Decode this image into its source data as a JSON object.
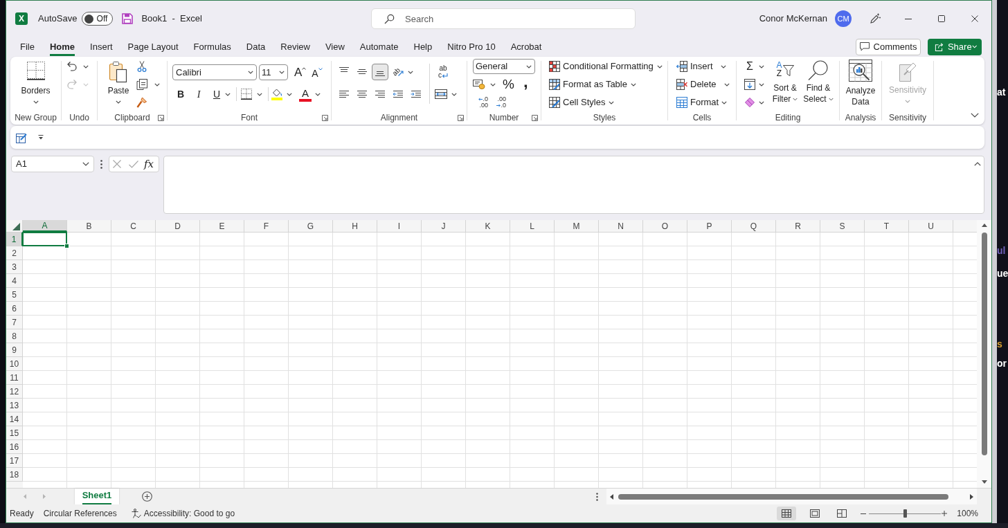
{
  "title_bar": {
    "app_icon_letter": "X",
    "autosave": {
      "label": "AutoSave",
      "on": false,
      "state_label": "Off"
    },
    "document_title": "Book1  -  Excel",
    "search": {
      "placeholder": "Search"
    },
    "account": {
      "name": "Conor McKernan",
      "initials": "CM"
    }
  },
  "ribbon_tabs": [
    {
      "label": "File",
      "selected": false
    },
    {
      "label": "Home",
      "selected": true
    },
    {
      "label": "Insert",
      "selected": false
    },
    {
      "label": "Page Layout",
      "selected": false
    },
    {
      "label": "Formulas",
      "selected": false
    },
    {
      "label": "Data",
      "selected": false
    },
    {
      "label": "Review",
      "selected": false
    },
    {
      "label": "View",
      "selected": false
    },
    {
      "label": "Automate",
      "selected": false
    },
    {
      "label": "Help",
      "selected": false
    },
    {
      "label": "Nitro Pro 10",
      "selected": false
    },
    {
      "label": "Acrobat",
      "selected": false
    }
  ],
  "comments_button": {
    "label": "Comments"
  },
  "share_button": {
    "label": "Share"
  },
  "ribbon": {
    "new_group": {
      "label": "New Group",
      "borders_button": "Borders"
    },
    "undo": {
      "label": "Undo",
      "undo_disabled": false,
      "redo_disabled": true
    },
    "clipboard": {
      "label": "Clipboard",
      "paste_button": "Paste"
    },
    "font": {
      "label": "Font",
      "font_name": "Calibri",
      "font_size": "11",
      "grow_glyph": "A",
      "shrink_glyph": "A",
      "bold_glyph": "B",
      "italic_glyph": "I",
      "underline_glyph": "U",
      "font_color_glyph": "A"
    },
    "alignment": {
      "label": "Alignment",
      "orientation_glyph": "ab",
      "wrap_glyph": [
        "ab",
        "c"
      ],
      "vertical_align": [
        {
          "selected": false
        },
        {
          "selected": false
        },
        {
          "selected": true
        }
      ]
    },
    "number": {
      "label": "Number",
      "format": "General",
      "percent_glyph": "%",
      "comma_glyph": ",",
      "increase_decimal": [
        ".0",
        ".00"
      ],
      "decrease_decimal": [
        ".00",
        ".0"
      ]
    },
    "styles": {
      "label": "Styles",
      "buttons": [
        "Conditional Formatting",
        "Format as Table",
        "Cell Styles"
      ]
    },
    "cells": {
      "label": "Cells",
      "buttons": [
        {
          "label": "Insert",
          "kind": "split"
        },
        {
          "label": "Delete",
          "kind": "split"
        },
        {
          "label": "Format",
          "kind": "menu"
        }
      ]
    },
    "editing": {
      "label": "Editing",
      "sum_glyph": "Σ",
      "sort_glyph": [
        "A",
        "Z"
      ],
      "sort_filter": [
        "Sort &",
        "Filter"
      ],
      "find_select": [
        "Find &",
        "Select"
      ]
    },
    "analysis": {
      "label": "Analysis",
      "analyze_data": [
        "Analyze",
        "Data"
      ]
    },
    "sensitivity": {
      "label": "Sensitivity",
      "button": {
        "label": "Sensitivity",
        "disabled": true
      }
    }
  },
  "formula_bar": {
    "name_box": "A1",
    "function_glyph": "fx",
    "expanded": true
  },
  "sheet": {
    "columns": [
      {
        "label": "A",
        "selected": true
      },
      {
        "label": "B",
        "selected": false
      },
      {
        "label": "C",
        "selected": false
      },
      {
        "label": "D",
        "selected": false
      },
      {
        "label": "E",
        "selected": false
      },
      {
        "label": "F",
        "selected": false
      },
      {
        "label": "G",
        "selected": false
      },
      {
        "label": "H",
        "selected": false
      },
      {
        "label": "I",
        "selected": false
      },
      {
        "label": "J",
        "selected": false
      },
      {
        "label": "K",
        "selected": false
      },
      {
        "label": "L",
        "selected": false
      },
      {
        "label": "M",
        "selected": false
      },
      {
        "label": "N",
        "selected": false
      },
      {
        "label": "O",
        "selected": false
      },
      {
        "label": "P",
        "selected": false
      },
      {
        "label": "Q",
        "selected": false
      },
      {
        "label": "R",
        "selected": false
      },
      {
        "label": "S",
        "selected": false
      },
      {
        "label": "T",
        "selected": false
      },
      {
        "label": "U",
        "selected": false
      }
    ],
    "rows": [
      {
        "label": "1",
        "selected": true
      },
      {
        "label": "2",
        "selected": false
      },
      {
        "label": "3",
        "selected": false
      },
      {
        "label": "4",
        "selected": false
      },
      {
        "label": "5",
        "selected": false
      },
      {
        "label": "6",
        "selected": false
      },
      {
        "label": "7",
        "selected": false
      },
      {
        "label": "8",
        "selected": false
      },
      {
        "label": "9",
        "selected": false
      },
      {
        "label": "10",
        "selected": false
      },
      {
        "label": "11",
        "selected": false
      },
      {
        "label": "12",
        "selected": false
      },
      {
        "label": "13",
        "selected": false
      },
      {
        "label": "14",
        "selected": false
      },
      {
        "label": "15",
        "selected": false
      },
      {
        "label": "16",
        "selected": false
      },
      {
        "label": "17",
        "selected": false
      },
      {
        "label": "18",
        "selected": false
      }
    ]
  },
  "sheet_tabs": [
    {
      "label": "Sheet1",
      "selected": true
    }
  ],
  "status_bar": {
    "mode": "Ready",
    "circular_references": "Circular References",
    "accessibility": "Accessibility: Good to go",
    "views": [
      {
        "selected": true
      },
      {
        "selected": false
      },
      {
        "selected": false
      }
    ],
    "zoom": {
      "level": 0.5,
      "reading": "100%"
    }
  },
  "background_window": {
    "fragments": [
      {
        "text": "at",
        "color": "#ffffff"
      },
      {
        "text": "ul",
        "color": "#6f5fb8"
      },
      {
        "text": "ue",
        "color": "#ffffff"
      },
      {
        "text": "s",
        "color": "#d9a030"
      },
      {
        "text": "or",
        "color": "#ffffff"
      }
    ]
  }
}
